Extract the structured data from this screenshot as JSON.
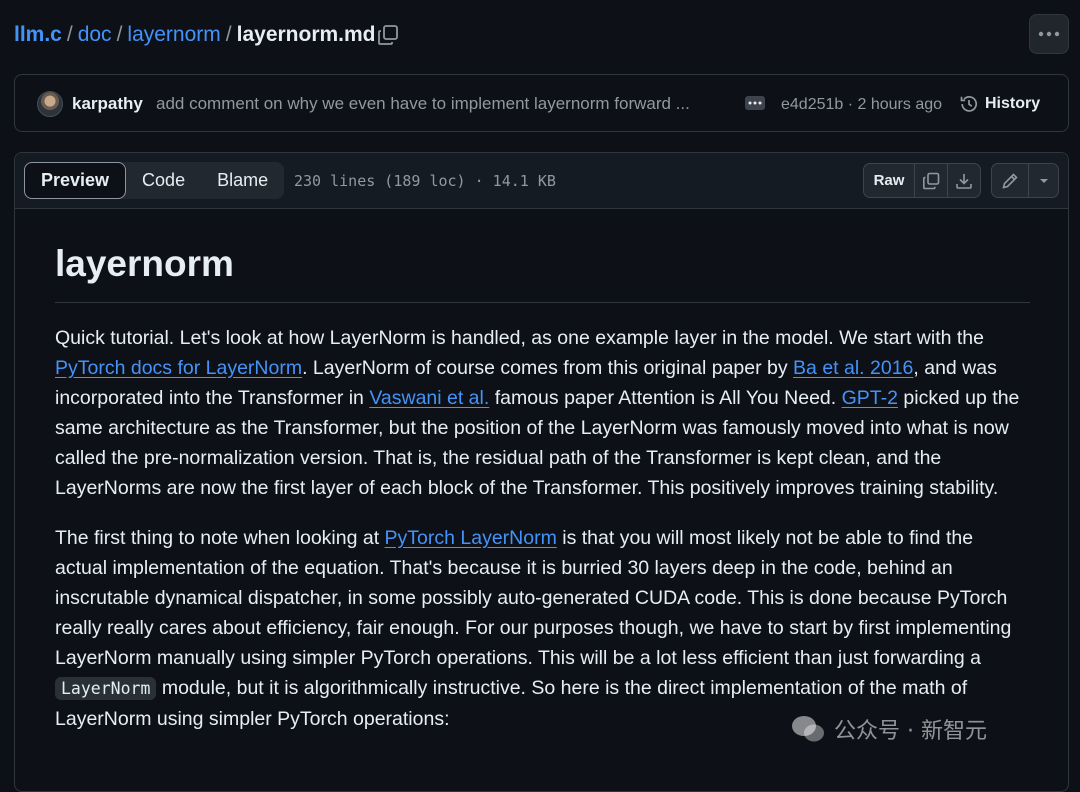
{
  "breadcrumb": {
    "repo": "llm.c",
    "separator": "/",
    "dir": "doc",
    "subdir": "layernorm",
    "file": "layernorm.md"
  },
  "icons": {
    "copy_path": "copy-icon",
    "more": "kebab-horizontal-icon",
    "history": "history-icon",
    "raw_copy": "copy-icon",
    "download": "download-icon",
    "edit": "pencil-icon",
    "dropdown": "triangle-down-icon"
  },
  "commit": {
    "author": "karpathy",
    "message": "add comment on why we even have to implement layernorm forward ...",
    "sha_time": "e4d251b · 2 hours ago",
    "history_label": "History"
  },
  "file_header": {
    "tabs": [
      {
        "label": "Preview",
        "active": true
      },
      {
        "label": "Code",
        "active": false
      },
      {
        "label": "Blame",
        "active": false
      }
    ],
    "meta": "230 lines (189 loc) · 14.1 KB",
    "raw_label": "Raw"
  },
  "markdown": {
    "title": "layernorm",
    "p1": [
      {
        "t": "Quick tutorial. Let's look at how LayerNorm is handled, as one example layer in the model. We start with the "
      },
      {
        "link": "PyTorch docs for LayerNorm"
      },
      {
        "t": ". LayerNorm of course comes from this original paper by "
      },
      {
        "link": "Ba et al. 2016"
      },
      {
        "t": ", and was incorporated into the Transformer in "
      },
      {
        "link": "Vaswani et al."
      },
      {
        "t": " famous paper Attention is All You Need. "
      },
      {
        "link": "GPT-2"
      },
      {
        "t": " picked up the same architecture as the Transformer, but the position of the LayerNorm was famously moved into what is now called the pre-normalization version. That is, the residual path of the Transformer is kept clean, and the LayerNorms are now the first layer of each block of the Transformer. This positively improves training stability."
      }
    ],
    "p2": [
      {
        "t": "The first thing to note when looking at "
      },
      {
        "link": "PyTorch LayerNorm"
      },
      {
        "t": " is that you will most likely not be able to find the actual implementation of the equation. That's because it is burried 30 layers deep in the code, behind an inscrutable dynamical dispatcher, in some possibly auto-generated CUDA code. This is done because PyTorch really really cares about efficiency, fair enough. For our purposes though, we have to start by first implementing LayerNorm manually using simpler PyTorch operations. This will be a lot less efficient than just forwarding a "
      },
      {
        "code": "LayerNorm"
      },
      {
        "t": " module, but it is algorithmically instructive. So here is the direct implementation of the math of LayerNorm using simpler PyTorch operations:"
      }
    ]
  },
  "watermark": {
    "text": "公众号 · 新智元"
  },
  "colors": {
    "background": "#0d1117",
    "border": "#30363d",
    "link": "#4493f8",
    "text": "#e6edf3",
    "muted": "#9198a1"
  }
}
